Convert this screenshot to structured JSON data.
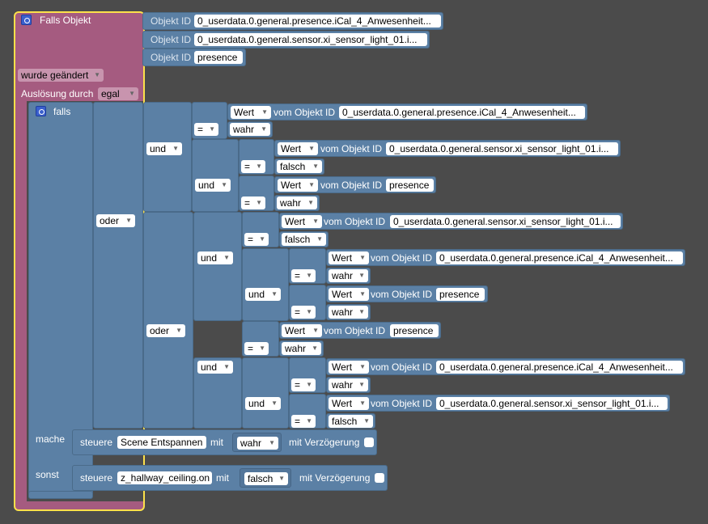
{
  "trigger": {
    "title": "Falls Objekt",
    "object_ids": [
      "0_userdata.0.general.presence.iCal_4_Anwesenheit...",
      "0_userdata.0.general.sensor.xi_sensor_light_01.i...",
      "presence"
    ],
    "object_id_label": "Objekt ID",
    "condition": "wurde geändert",
    "ausloesung_label": "Auslösung durch",
    "ausloesung_value": "egal"
  },
  "logic": {
    "falls_label": "falls",
    "mache_label": "mache",
    "sonst_label": "sonst",
    "und": "und",
    "oder": "oder",
    "eq": "=",
    "wert": "Wert",
    "vom_objekt_id": "vom Objekt ID",
    "wahr": "wahr",
    "falsch": "falsch",
    "ids": {
      "ical": "0_userdata.0.general.presence.iCal_4_Anwesenheit...",
      "ical_long": "0_userdata.0.general.presence.iCal_4_Anwesenheit...",
      "light": "0_userdata.0.general.sensor.xi_sensor_light_01.i...",
      "presence": "presence"
    }
  },
  "actions": {
    "mache": {
      "steuere": "steuere",
      "target": "Scene Entspannen",
      "mit": "mit",
      "value": "wahr",
      "delay_label": "mit Verzögerung"
    },
    "sonst": {
      "steuere": "steuere",
      "target": "z_hallway_ceiling.on",
      "mit": "mit",
      "value": "falsch",
      "delay_label": "mit Verzögerung"
    }
  }
}
